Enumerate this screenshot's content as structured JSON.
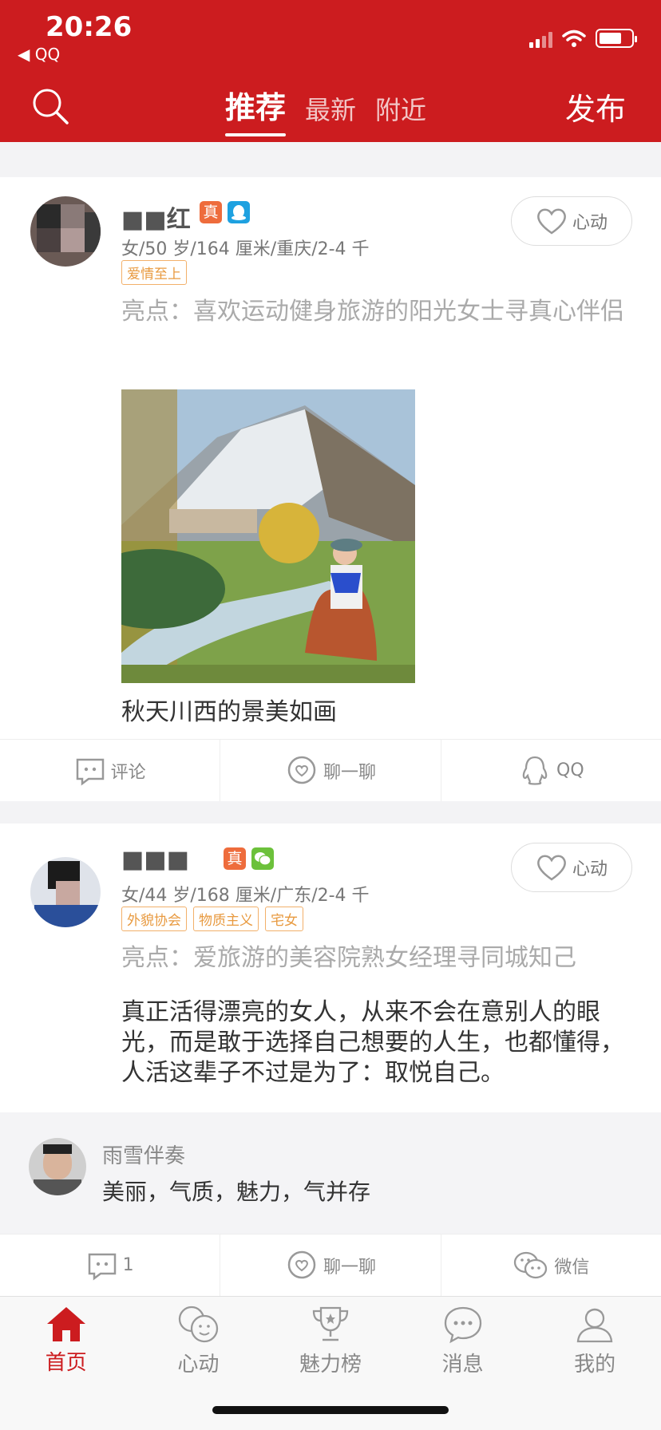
{
  "status": {
    "time": "20:26",
    "back_app": "◀ QQ"
  },
  "header": {
    "tabs": [
      {
        "label": "推荐",
        "active": true
      },
      {
        "label": "最新",
        "active": false
      },
      {
        "label": "附近",
        "active": false
      }
    ],
    "publish_label": "发布"
  },
  "posts": [
    {
      "name": "■■红",
      "badge_real": "真",
      "info": "女/50 岁/164 厘米/重庆/2-4 千",
      "tags": [
        "爱情至上"
      ],
      "like_label": "心动",
      "highlight": "亮点：喜欢运动健身旅游的阳光女士寻真心伴侣",
      "caption": "秋天川西的景美如画",
      "actions": {
        "comment": "评论",
        "chat": "聊一聊",
        "contact": "QQ"
      }
    },
    {
      "name": "■■■",
      "badge_real": "真",
      "info": "女/44 岁/168 厘米/广东/2-4 千",
      "tags": [
        "外貌协会",
        "物质主义",
        "宅女"
      ],
      "like_label": "心动",
      "highlight": "亮点：爱旅游的美容院熟女经理寻同城知己",
      "text": "真正活得漂亮的女人，从来不会在意别人的眼光，而是敢于选择自己想要的人生，也都懂得，人活这辈子不过是为了：取悦自己。",
      "comment": {
        "user": "雨雪伴奏",
        "text": "美丽，气质，魅力，气并存"
      },
      "actions": {
        "comment": "1",
        "chat": "聊一聊",
        "contact": "微信"
      }
    }
  ],
  "bottom_nav": [
    {
      "label": "首页",
      "active": true,
      "icon": "home-icon"
    },
    {
      "label": "心动",
      "active": false,
      "icon": "faces-icon"
    },
    {
      "label": "魅力榜",
      "active": false,
      "icon": "trophy-icon"
    },
    {
      "label": "消息",
      "active": false,
      "icon": "message-icon"
    },
    {
      "label": "我的",
      "active": false,
      "icon": "profile-icon"
    }
  ],
  "colors": {
    "brand_red": "#cc1c1f",
    "tag_orange": "#e89a40",
    "qq_blue": "#1ea1e0",
    "wechat_green": "#6cc13b",
    "badge_orange": "#ee6c3c"
  }
}
